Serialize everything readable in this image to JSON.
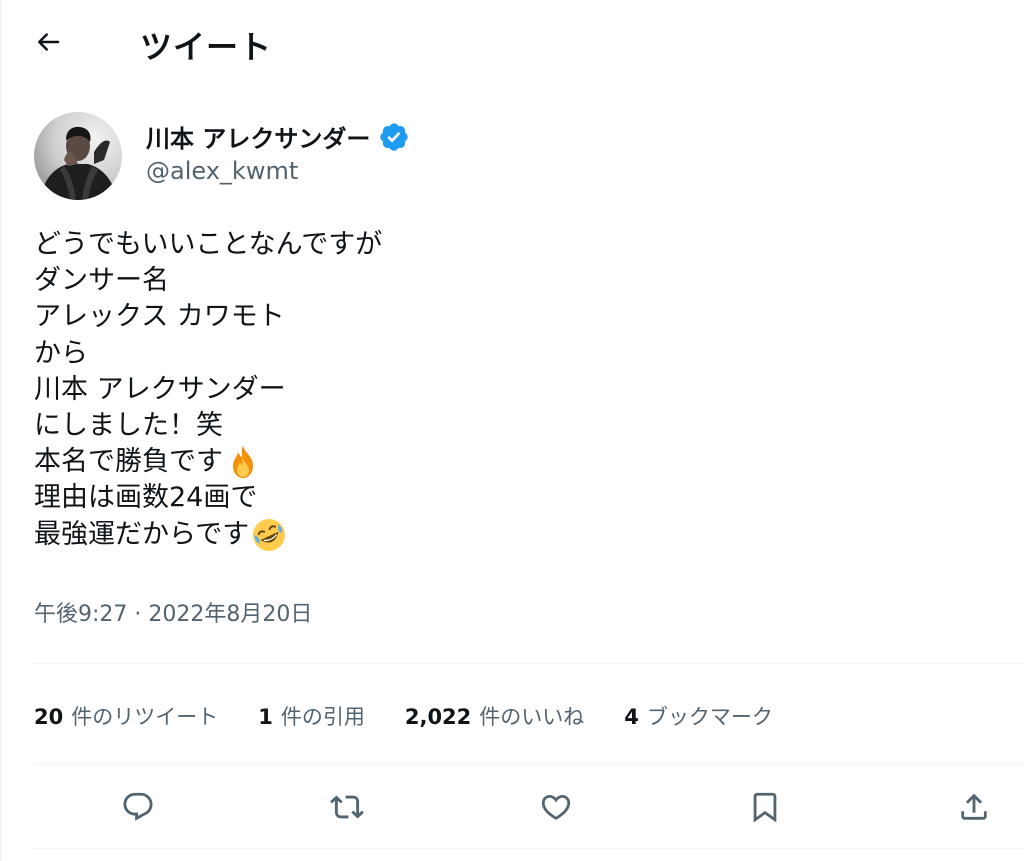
{
  "header": {
    "title": "ツイート",
    "back_icon": "arrow-left-icon"
  },
  "author": {
    "name": "川本 アレクサンダー",
    "handle": "@alex_kwmt",
    "verified": true,
    "verified_color": "#1d9bf0"
  },
  "tweet": {
    "lines": [
      "どうでもいいことなんですが",
      "ダンサー名",
      "アレックス カワモト",
      "から",
      "川本 アレクサンダー",
      "にしました！笑",
      "本名で勝負です",
      "理由は画数24画で",
      "最強運だからです"
    ],
    "emojis": {
      "line_7": "fire-emoji",
      "line_9": "rofl-emoji"
    },
    "timestamp": "午後9:27 · 2022年8月20日"
  },
  "stats": [
    {
      "number": "20",
      "label": "件のリツイート"
    },
    {
      "number": "1",
      "label": "件の引用"
    },
    {
      "number": "2,022",
      "label": "件のいいね"
    },
    {
      "number": "4",
      "label": "ブックマーク"
    }
  ],
  "actions": [
    {
      "name": "reply",
      "icon": "reply-icon"
    },
    {
      "name": "retweet",
      "icon": "retweet-icon"
    },
    {
      "name": "like",
      "icon": "heart-icon"
    },
    {
      "name": "bookmark",
      "icon": "bookmark-icon"
    },
    {
      "name": "share",
      "icon": "share-icon"
    }
  ],
  "colors": {
    "text": "#0f1419",
    "secondary": "#536471",
    "divider": "#eff3f4",
    "accent": "#1d9bf0"
  }
}
